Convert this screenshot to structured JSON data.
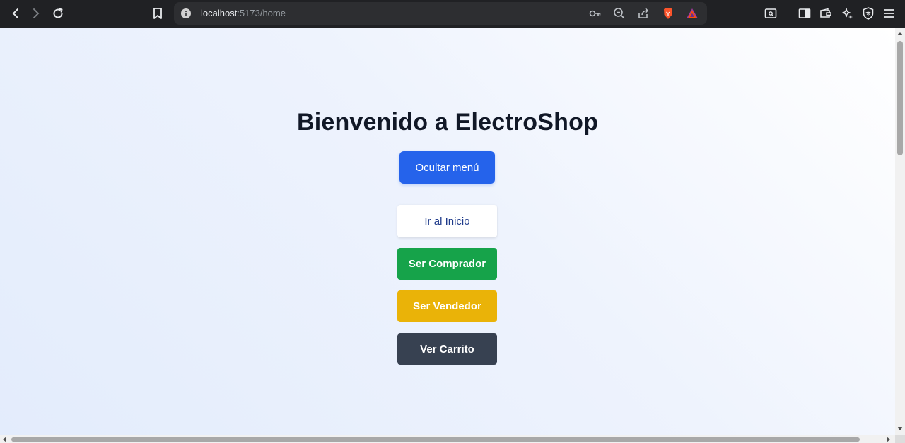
{
  "browser": {
    "url_host": "localhost",
    "url_path": ":5173/home"
  },
  "page": {
    "title": "Bienvenido a ElectroShop",
    "menu_toggle_label": "Ocultar menú",
    "menu": [
      {
        "label": "Ir al Inicio",
        "color": "#ffffff"
      },
      {
        "label": "Ser Comprador",
        "color": "#16a34a"
      },
      {
        "label": "Ser Vendedor",
        "color": "#eab308"
      },
      {
        "label": "Ver Carrito",
        "color": "#374151"
      }
    ],
    "accent": "#2563eb"
  }
}
